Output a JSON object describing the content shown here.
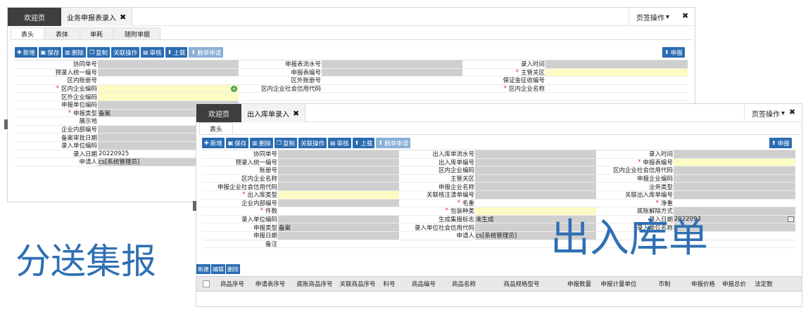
{
  "back_window": {
    "tabs": {
      "welcome": "欢迎页",
      "active": "业务申报表录入"
    },
    "page_ops": "页签操作",
    "subtabs": [
      "表头",
      "表体",
      "单耗",
      "随附单据"
    ],
    "toolbar": [
      "新增",
      "保存",
      "删除",
      "复制",
      "关联操作",
      "审核",
      "上载",
      "删单申请"
    ],
    "declare_btn": "申报",
    "form": {
      "r1": {
        "c1": "协同单号",
        "c2": "申报表流水号",
        "c3": "录入时间"
      },
      "r2": {
        "c1": "预录入统一编号",
        "c2": "申报表编号",
        "c3": "主管关区"
      },
      "r3": {
        "c1": "区内账册号",
        "c2": "区外账册号",
        "c3": "保证金征收编号"
      },
      "r4": {
        "c1": "区内企业编码",
        "c2": "区内企业社会信用代码",
        "c3": "区内企业名称"
      },
      "r5": {
        "c1": "区外企业编码"
      },
      "r6": {
        "c1": "申报单位编码"
      },
      "r7": {
        "c1": "申报类型",
        "v1": "备案"
      },
      "r8": {
        "c1": "展示地"
      },
      "r9": {
        "c1": "企业内部编号"
      },
      "r10": {
        "c1": "备案审批日期"
      },
      "r11": {
        "c1": "录入单位编码"
      },
      "r12": {
        "c1": "录入日期",
        "v1": "20220925"
      },
      "r13": {
        "c1": "申请人",
        "v1": "cs[系统管理员]"
      }
    }
  },
  "front_window": {
    "tabs": {
      "welcome": "欢迎页",
      "active": "出入库单录入"
    },
    "page_ops": "页签操作",
    "subtabs": [
      "表头"
    ],
    "toolbar": [
      "新增",
      "保存",
      "删除",
      "复制",
      "关联操作",
      "审核",
      "上载",
      "删单申请"
    ],
    "declare_btn": "申报",
    "form": [
      {
        "a": "协同单号",
        "b": "出入库单流水号",
        "c": "录入时间"
      },
      {
        "a": "预录入统一编号",
        "b": "出入库单编号",
        "c": "申报表编号"
      },
      {
        "a": "账册号",
        "b": "区内企业编码",
        "c": "区内企业社会信用代码"
      },
      {
        "a": "区内企业名称",
        "b": "主管关区",
        "c": "申报企业编码"
      },
      {
        "a": "申报企业社会信用代码",
        "b": "申报企业名称",
        "c": "业务类型"
      },
      {
        "a": "出入库类型",
        "b": "关联核注清单编号",
        "c": "关联出入库单编号"
      },
      {
        "a": "企业内部编号",
        "b": "毛重",
        "c": "净重"
      },
      {
        "a": "件数",
        "b": "包装种类",
        "c": "底账解除方式"
      },
      {
        "a": "录入单位编码",
        "b": "生成集报标志",
        "bv": "未生成",
        "c": "录入日期",
        "cv": "2022093"
      },
      {
        "a": "申报类型",
        "av": "备案",
        "b": "录入单位社会信用代码",
        "c": "录入单位名称"
      },
      {
        "a": "申报日期",
        "b": "申请人",
        "bv": "cs[系统管理员]"
      },
      {
        "a": "备注"
      }
    ],
    "list_toolbar": [
      "新建",
      "编辑",
      "删除"
    ],
    "columns": [
      "商品序号",
      "申请表序号",
      "底账商品序号",
      "关联商品序号",
      "料号",
      "商品编号",
      "商品名称",
      "商品规格型号",
      "申报数量",
      "申报计量单位",
      "币制",
      "申报价格",
      "申报总价",
      "法定数"
    ]
  },
  "overlay": {
    "left": "分送集报",
    "right": "出入库单"
  },
  "colors": {
    "accent": "#2b6cb1",
    "required_yellow": "#fbfbc3",
    "readonly_gray": "#cfcfcf",
    "tab_dark": "#3e3e3e",
    "overlay_blue": "#2f6fb4"
  }
}
